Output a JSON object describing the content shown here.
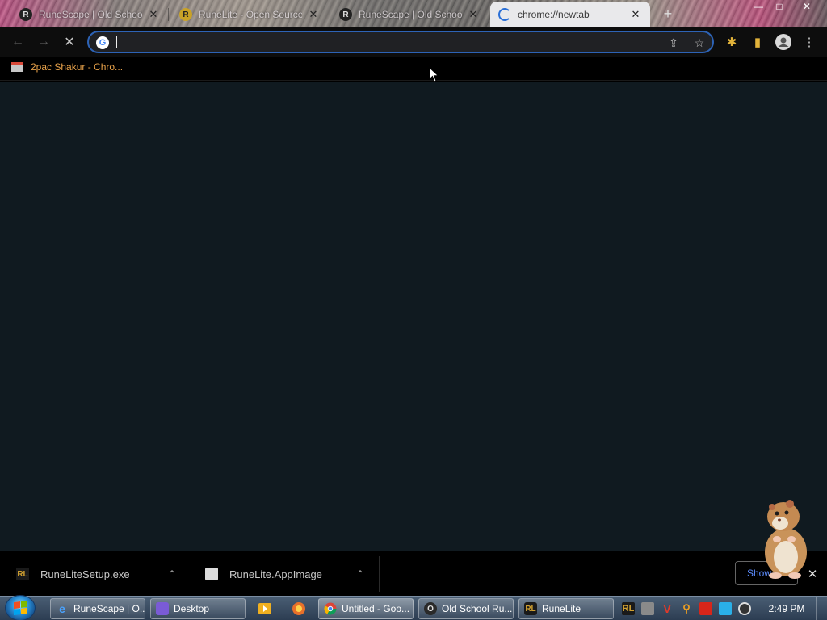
{
  "browser": {
    "tabs": [
      {
        "title": "RuneScape | Old School",
        "favicon": "runescape-icon",
        "active": false
      },
      {
        "title": "RuneLite - Open Source",
        "favicon": "runelite-icon",
        "active": false
      },
      {
        "title": "RuneScape | Old School",
        "favicon": "runescape-icon",
        "active": false
      },
      {
        "title": "chrome://newtab",
        "favicon": "loading-spinner-icon",
        "active": true
      }
    ],
    "new_tab_label": "+",
    "window_controls": {
      "minimize": "—",
      "maximize": "□",
      "close": "✕"
    },
    "toolbar": {
      "back_icon": "←",
      "forward_icon": "→",
      "stop_icon": "✕",
      "address_value": "",
      "google_icon_letter": "G",
      "share_icon": "⇪",
      "star_icon": "☆",
      "extensions_icon": "✱",
      "side_panel_icon": "▮",
      "profile_icon": "●",
      "menu_icon": "⋮"
    },
    "bookmarks": [
      {
        "label": "2pac Shakur - Chro..."
      }
    ]
  },
  "downloads": {
    "items": [
      {
        "filename": "RuneLiteSetup.exe",
        "icon": "runelite-icon",
        "chevron": "⌃"
      },
      {
        "filename": "RuneLite.AppImage",
        "icon": "file-icon",
        "chevron": "⌃"
      }
    ],
    "show_all_label": "Show all",
    "close_icon": "✕"
  },
  "taskbar": {
    "buttons": [
      {
        "label": "RuneScape | O...",
        "icon": "ie-icon"
      },
      {
        "label": "Desktop",
        "icon": "desktop-icon"
      },
      {
        "label": "Untitled - Goo...",
        "icon": "chrome-icon"
      },
      {
        "label": "Old School Ru...",
        "icon": "osrs-icon"
      },
      {
        "label": "RuneLite",
        "icon": "runelite-icon"
      }
    ],
    "quick_launch": [
      {
        "icon": "media-player-icon"
      },
      {
        "icon": "firefox-like-icon"
      }
    ],
    "tray_icons": [
      "runelite-tray-icon",
      "app-tray-icon",
      "v-tray-icon",
      "search-tray-icon",
      "flag-tray-icon",
      "monitor-tray-icon",
      "volume-tray-icon"
    ],
    "clock": "2:49 PM"
  },
  "colors": {
    "content_bg": "#101a20",
    "omnibox_border": "#2d63b6",
    "bookmark_text": "#e8a24a",
    "show_all_text": "#5b8cff"
  }
}
